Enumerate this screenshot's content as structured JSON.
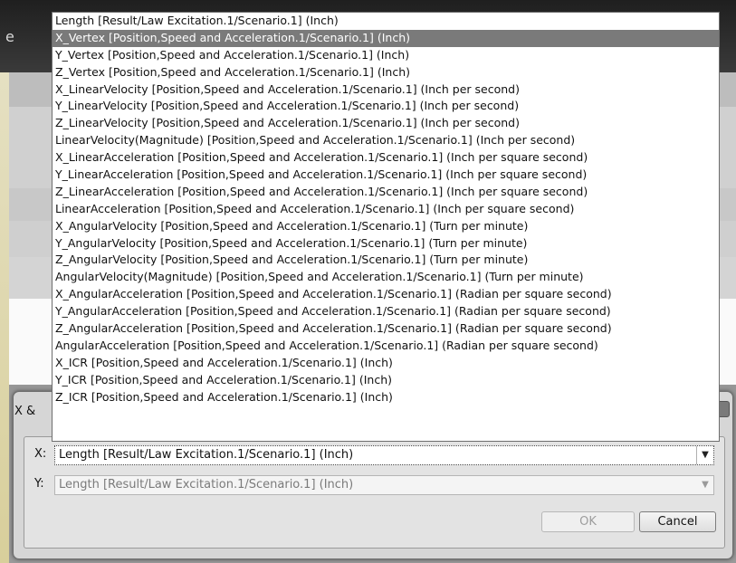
{
  "background": {
    "title_fragment": "e"
  },
  "dialog": {
    "title": "X &",
    "x_label": "X:",
    "y_label": "Y:",
    "x_value": "Length [Result/Law Excitation.1/Scenario.1] (Inch)",
    "y_value": "Length [Result/Law Excitation.1/Scenario.1] (Inch)",
    "ok_label": "OK",
    "cancel_label": "Cancel"
  },
  "dropdown": {
    "selected_index": 1,
    "items": [
      "Length [Result/Law Excitation.1/Scenario.1] (Inch)",
      "X_Vertex [Position,Speed and Acceleration.1/Scenario.1] (Inch)",
      "Y_Vertex [Position,Speed and Acceleration.1/Scenario.1] (Inch)",
      "Z_Vertex [Position,Speed and Acceleration.1/Scenario.1] (Inch)",
      "X_LinearVelocity [Position,Speed and Acceleration.1/Scenario.1] (Inch per second)",
      "Y_LinearVelocity [Position,Speed and Acceleration.1/Scenario.1] (Inch per second)",
      "Z_LinearVelocity [Position,Speed and Acceleration.1/Scenario.1] (Inch per second)",
      "LinearVelocity(Magnitude) [Position,Speed and Acceleration.1/Scenario.1] (Inch per second)",
      "X_LinearAcceleration [Position,Speed and Acceleration.1/Scenario.1] (Inch per square second)",
      "Y_LinearAcceleration [Position,Speed and Acceleration.1/Scenario.1] (Inch per square second)",
      "Z_LinearAcceleration [Position,Speed and Acceleration.1/Scenario.1] (Inch per square second)",
      "LinearAcceleration [Position,Speed and Acceleration.1/Scenario.1] (Inch per square second)",
      "X_AngularVelocity [Position,Speed and Acceleration.1/Scenario.1] (Turn per minute)",
      "Y_AngularVelocity [Position,Speed and Acceleration.1/Scenario.1] (Turn per minute)",
      "Z_AngularVelocity [Position,Speed and Acceleration.1/Scenario.1] (Turn per minute)",
      "AngularVelocity(Magnitude) [Position,Speed and Acceleration.1/Scenario.1] (Turn per minute)",
      "X_AngularAcceleration [Position,Speed and Acceleration.1/Scenario.1] (Radian per square second)",
      "Y_AngularAcceleration [Position,Speed and Acceleration.1/Scenario.1] (Radian per square second)",
      "Z_AngularAcceleration [Position,Speed and Acceleration.1/Scenario.1] (Radian per square second)",
      "AngularAcceleration [Position,Speed and Acceleration.1/Scenario.1] (Radian per square second)",
      "X_ICR [Position,Speed and Acceleration.1/Scenario.1] (Inch)",
      "Y_ICR [Position,Speed and Acceleration.1/Scenario.1] (Inch)",
      "Z_ICR [Position,Speed and Acceleration.1/Scenario.1] (Inch)"
    ]
  }
}
